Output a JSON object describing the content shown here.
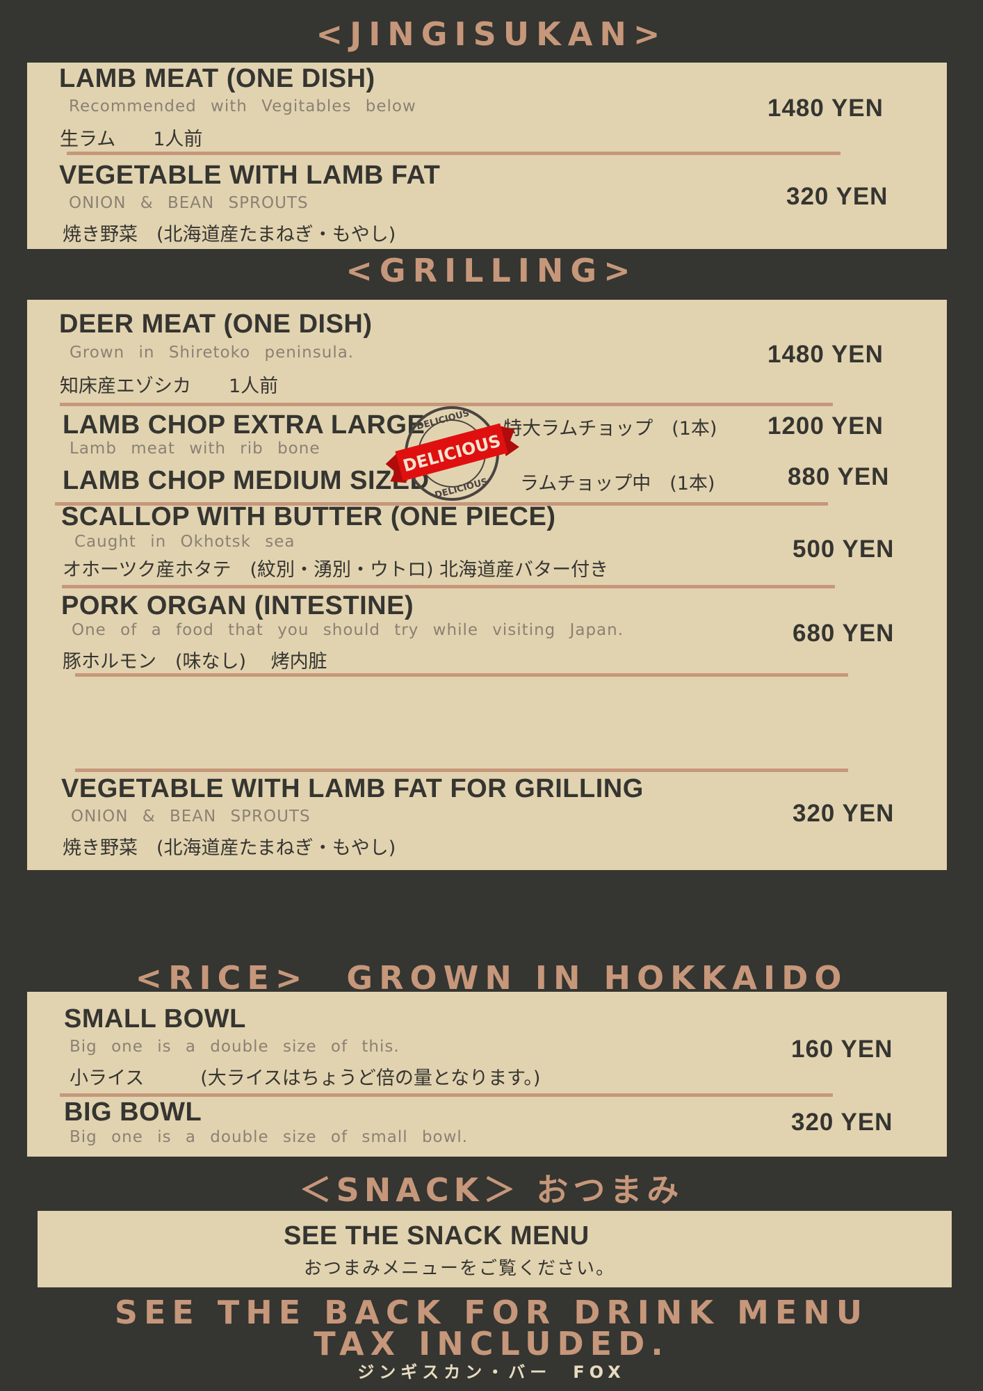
{
  "sections": {
    "jingisukan": {
      "title": "<JINGISUKAN>",
      "items": [
        {
          "name": "LAMB MEAT (ONE DISH)",
          "desc": "Recommended with Vegitables below",
          "jp": "生ラム　　1人前",
          "price": "1480 YEN"
        },
        {
          "name": "VEGETABLE WITH LAMB FAT",
          "desc": "ONION & BEAN SPROUTS",
          "jp": "焼き野菜　(北海道産たまねぎ・もやし)",
          "price": "320 YEN"
        }
      ]
    },
    "grilling": {
      "title": "<GRILLING>",
      "items": [
        {
          "name": "DEER MEAT (ONE DISH)",
          "desc": "Grown in Shiretoko peninsula.",
          "jp": "知床産エゾシカ　　1人前",
          "price": "1480 YEN"
        },
        {
          "name": "LAMB CHOP EXTRA LARGE",
          "desc": "Lamb meat with rib bone",
          "jp": "特大ラムチョップ　(1本)",
          "price": "1200 YEN"
        },
        {
          "name": "LAMB CHOP MEDIUM SIZED",
          "jp": "ラムチョップ中　(1本)",
          "price": "880 YEN"
        },
        {
          "name": "SCALLOP WITH BUTTER (ONE PIECE)",
          "desc": "Caught in Okhotsk sea",
          "jp": "オホーツク産ホタテ　(紋別・湧別・ウトロ) 北海道産バター付き",
          "price": "500 YEN"
        },
        {
          "name": "PORK ORGAN (INTESTINE)",
          "desc": "One of a food that you should try while visiting Japan.",
          "jp": "豚ホルモン　(味なし)　 烤内脏",
          "price": "680 YEN"
        },
        {
          "name": "VEGETABLE WITH LAMB FAT FOR GRILLING",
          "desc": "ONION & BEAN SPROUTS",
          "jp": "焼き野菜　(北海道産たまねぎ・もやし)",
          "price": "320 YEN"
        }
      ],
      "stamp": {
        "banner": "DELICIOUS",
        "ring_top": "DELICIOUS",
        "ring_bottom": "DELICIOUS"
      }
    },
    "rice": {
      "title": "<RICE>　GROWN IN HOKKAIDO",
      "items": [
        {
          "name": "SMALL BOWL",
          "desc": "Big one is a double size of this.",
          "jp": "小ライス　　　(大ライスはちょうど倍の量となります。)",
          "price": "160 YEN"
        },
        {
          "name": "BIG BOWL",
          "desc": "Big one is a double size of small bowl.",
          "price": "320 YEN"
        }
      ]
    },
    "snack": {
      "title": "＜SNACK＞ おつまみ",
      "heading": "SEE THE SNACK MENU",
      "jp": "おつまみメニューをご覧ください。"
    }
  },
  "footer": {
    "line1": "SEE THE BACK FOR DRINK MENU",
    "line2": "TAX INCLUDED.",
    "shop": "ジンギスカン・バー　FOX"
  },
  "colors": {
    "background": "#353531",
    "panel": "#e2d3b0",
    "accent": "#c6977a",
    "stamp_red": "#e01010"
  }
}
